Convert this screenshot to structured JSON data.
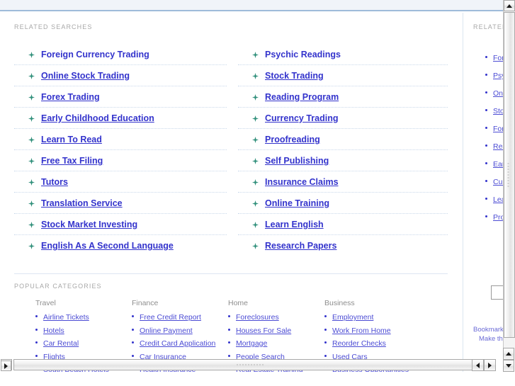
{
  "page": {
    "related_searches_heading": "RELATED SEARCHES",
    "popular_categories_heading": "POPULAR CATEGORIES",
    "rail_heading": "RELATED"
  },
  "related_searches": {
    "left_column": [
      "Foreign Currency Trading",
      "Online Stock Trading",
      "Forex Trading",
      "Early Childhood Education",
      "Learn To Read",
      "Free Tax Filing",
      "Tutors",
      "Translation Service",
      "Stock Market Investing",
      "English As A Second Language"
    ],
    "right_column": [
      "Psychic Readings",
      "Stock Trading",
      "Reading Program",
      "Currency Trading",
      "Proofreading",
      "Self Publishing",
      "Insurance Claims",
      "Online Training",
      "Learn English",
      "Research Papers"
    ]
  },
  "popular_categories": [
    {
      "heading": "Travel",
      "links": [
        "Airline Tickets",
        "Hotels",
        "Car Rental",
        "Flights",
        "South Beach Hotels"
      ]
    },
    {
      "heading": "Finance",
      "links": [
        "Free Credit Report",
        "Online Payment",
        "Credit Card Application",
        "Car Insurance",
        "Health Insurance"
      ]
    },
    {
      "heading": "Home",
      "links": [
        "Foreclosures",
        "Houses For Sale",
        "Mortgage",
        "People Search",
        "Real Estate Training"
      ]
    },
    {
      "heading": "Business",
      "links": [
        "Employment",
        "Work From Home",
        "Reorder Checks",
        "Used Cars",
        "Business Opportunities"
      ]
    }
  ],
  "rail": {
    "items": [
      "Foreign Currency Trading",
      "Psychic Readings",
      "Online Stock Trading",
      "Stock Trading",
      "Forex Trading",
      "Reading Program",
      "Early Childhood Education",
      "Currency Trading",
      "Learn To Read",
      "Proofreading"
    ],
    "search_value": "",
    "search_placeholder": "",
    "bookmark_link": "Bookmark",
    "homepage_link": "Make this"
  },
  "colors": {
    "link": "#3333cc",
    "link_small": "#4b4bd4",
    "heading_gray": "#a8a8a8",
    "band_bg": "#f0f4f9",
    "band_border": "#9fbbda",
    "bullet_star": "#2f8f7a",
    "divider": "#dde6f2"
  },
  "scrollbars": {
    "vertical_up_icon": "arrow-up-icon",
    "vertical_down_icon": "arrow-down-icon",
    "horizontal_left_icon": "arrow-left-icon",
    "horizontal_right_icon": "arrow-right-icon"
  }
}
